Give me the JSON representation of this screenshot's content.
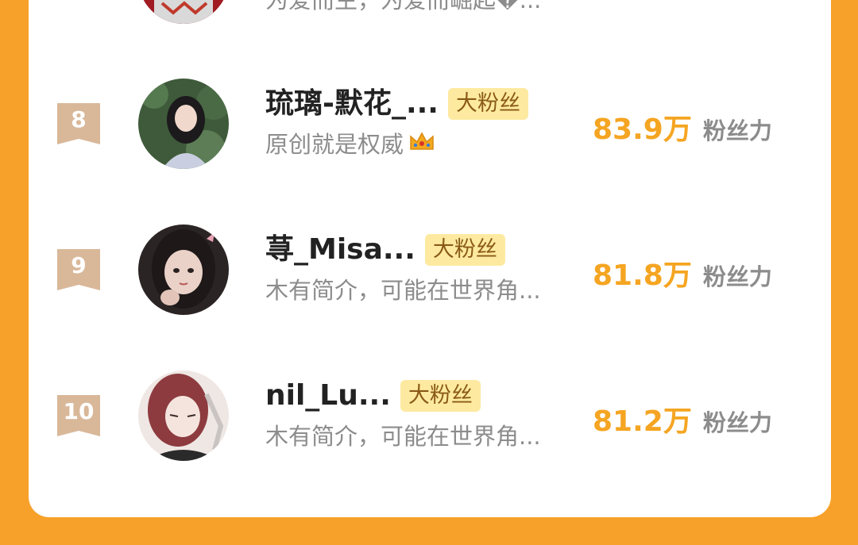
{
  "partial_row": {
    "bio": "为爱而生，为爱而崛起�..."
  },
  "rows": [
    {
      "rank": "8",
      "name": "琉璃-默花_...",
      "tag": "大粉丝",
      "bio": "原创就是权威",
      "bio_icon": "crown-icon",
      "score": "83.9万",
      "score_label": "粉丝力"
    },
    {
      "rank": "9",
      "name": "荨_Misa...",
      "tag": "大粉丝",
      "bio": "木有简介，可能在世界角...",
      "score": "81.8万",
      "score_label": "粉丝力"
    },
    {
      "rank": "10",
      "name": "nil_Lu...",
      "tag": "大粉丝",
      "bio": "木有简介，可能在世界角...",
      "score": "81.2万",
      "score_label": "粉丝力"
    }
  ],
  "colors": {
    "background": "#f7a12a",
    "score": "#f5a522",
    "tag_bg": "#fdeaa0",
    "tag_text": "#8a5a17",
    "badge": "#d9b89a"
  }
}
